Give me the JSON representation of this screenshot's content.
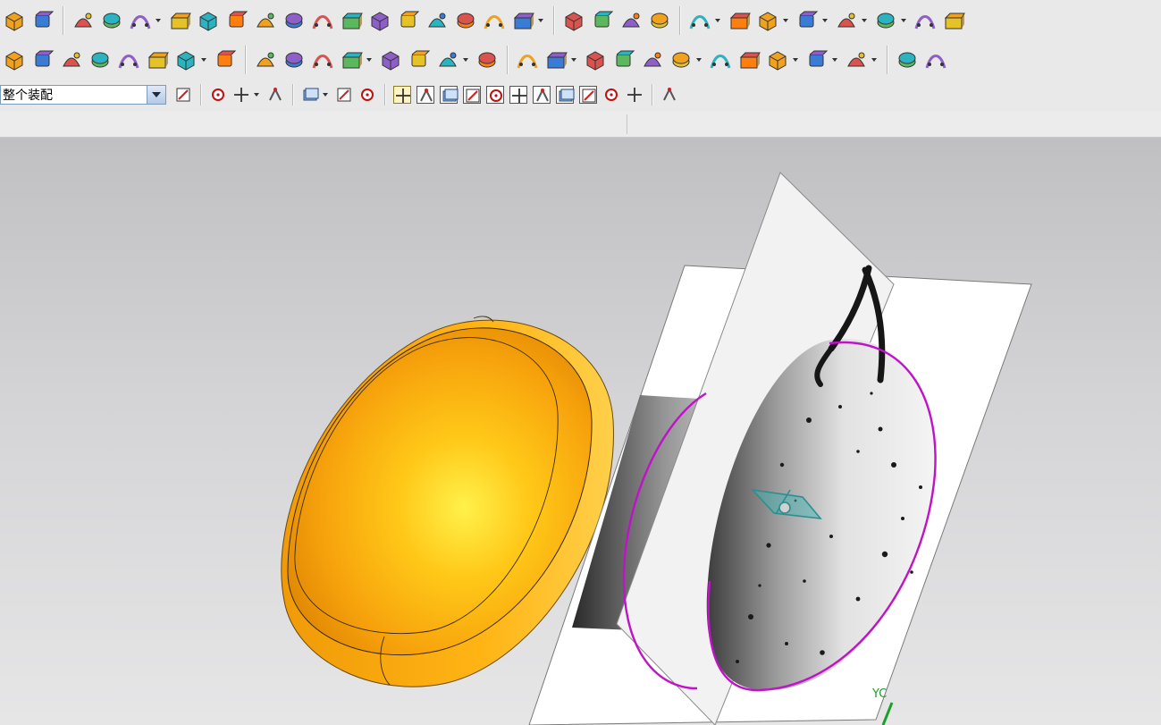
{
  "toolbar_row1": {
    "icons": [
      "curve-through-points-icon",
      "surface-edit-icon",
      "extrude-icon",
      "array-feature-icon",
      "sketch-points-icon",
      "boolean-shape-icon",
      "book-open-icon",
      "block-icon",
      "blend-icon",
      "chamfer-face-icon",
      "offset-face-icon",
      "hollow-box-icon",
      "draft-icon",
      "sew-icon",
      "trim-body-icon",
      "split-body-icon",
      "sweep-icon",
      "swept-curve-icon",
      "cube-icon",
      "tray-icon",
      "hex-body-icon",
      "sphere-icon",
      "feature-a-icon",
      "feature-b-icon",
      "feature-c-icon",
      "feature-d-icon",
      "feature-e-icon",
      "feature-f-icon",
      "feature-g-icon",
      "feature-h-icon"
    ]
  },
  "toolbar_row2": {
    "icons": [
      "assembly-icon",
      "wave-link-icon",
      "component-add-icon",
      "mate-icon",
      "explode-icon",
      "clearance-icon",
      "reposition-icon",
      "mirror-icon",
      "spline-icon",
      "studio-curve-icon",
      "line-icon",
      "fan-curves-icon",
      "flow-surface-icon",
      "ribbon-icon",
      "mesh-surface-icon",
      "measure-icon",
      "analyze-icon",
      "wireframe-surface-icon",
      "swept-surface-icon",
      "layered-face-icon",
      "heat-map-icon",
      "color-face-icon",
      "zebra-icon",
      "draft-analysis-icon",
      "section-icon",
      "view-orient-icon",
      "highlight-icon",
      "pen-icon",
      "flip-icon"
    ]
  },
  "toolbar_row3": {
    "assembly_scope": "整个装配",
    "icons": [
      "filter-icon",
      "snap-point-icon",
      "snap-arrow-icon",
      "snap-line-icon",
      "select-box-icon",
      "select-face-icon",
      "select-body-icon",
      "snap-all-icon",
      "snap-center-icon",
      "endpoint-icon",
      "midpoint-icon",
      "control-point-icon",
      "intersection-icon",
      "arc-center-icon",
      "quadrant-icon",
      "existing-point-icon",
      "point-on-curve-icon",
      "point-on-face-icon",
      "grid-icon"
    ]
  },
  "viewport": {
    "axis_label": "YC",
    "colors": {
      "body_main": "#f5a20e",
      "body_highlight": "#ffd21a",
      "section_curve": "#c012c8",
      "datum_plane": "#ffffff",
      "axis_green": "#1aa02a"
    }
  }
}
